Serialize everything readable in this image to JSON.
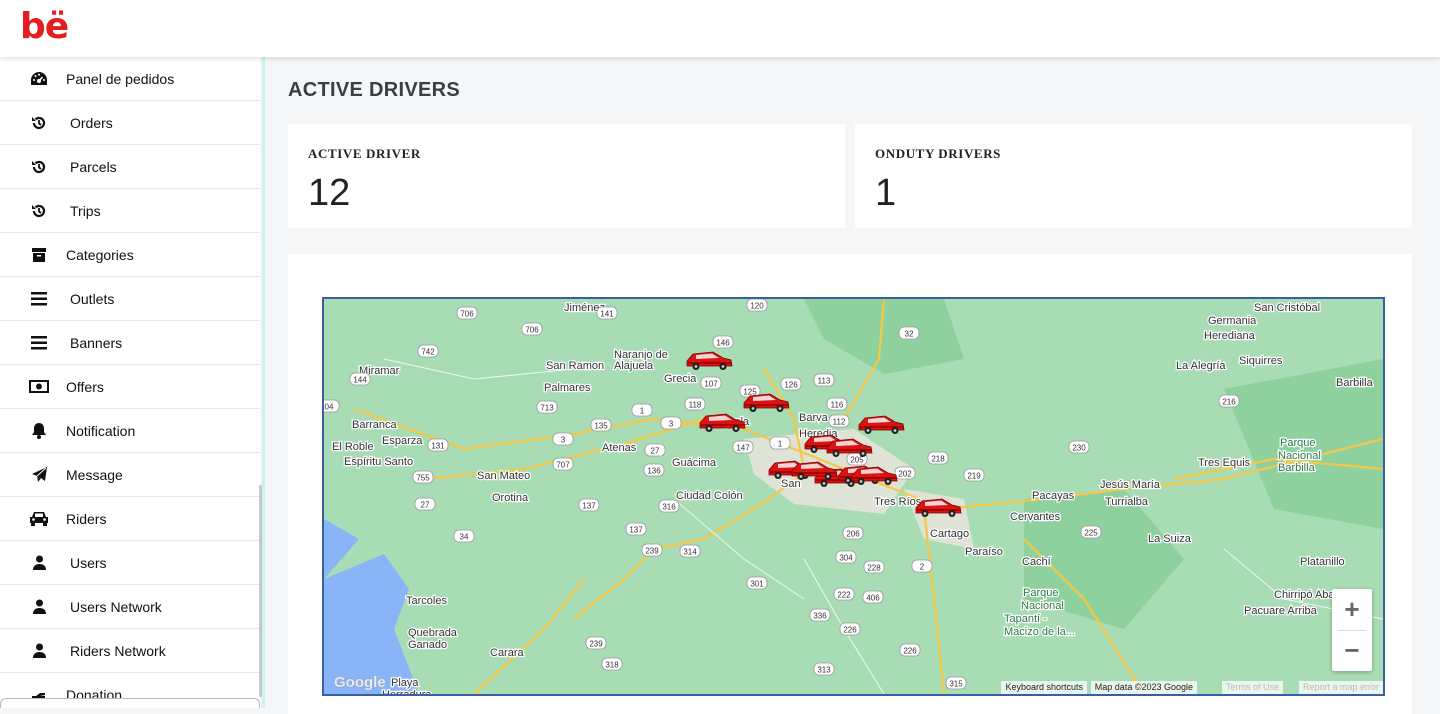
{
  "brand": {
    "logo": "bë",
    "color": "#e41e1e"
  },
  "sidebar": {
    "items": [
      {
        "label": "Panel de pedidos",
        "icon": "dashboard-icon"
      },
      {
        "label": "Orders",
        "icon": "history-icon"
      },
      {
        "label": "Parcels",
        "icon": "history-icon"
      },
      {
        "label": "Trips",
        "icon": "history-icon"
      },
      {
        "label": "Categories",
        "icon": "archive-icon"
      },
      {
        "label": "Outlets",
        "icon": "bars-icon"
      },
      {
        "label": "Banners",
        "icon": "bars-icon"
      },
      {
        "label": "Offers",
        "icon": "money-bill-icon"
      },
      {
        "label": "Notification",
        "icon": "bell-icon"
      },
      {
        "label": "Message",
        "icon": "paper-plane-icon"
      },
      {
        "label": "Riders",
        "icon": "car-icon"
      },
      {
        "label": "Users",
        "icon": "user-icon"
      },
      {
        "label": "Users Network",
        "icon": "user-icon"
      },
      {
        "label": "Riders Network",
        "icon": "user-icon"
      },
      {
        "label": "Donation",
        "icon": "hand-icon"
      }
    ]
  },
  "page": {
    "title": "ACTIVE DRIVERS"
  },
  "stats": {
    "active_label": "ACTIVE DRIVER",
    "active_value": "12",
    "onduty_label": "ONDUTY DRIVERS",
    "onduty_value": "1"
  },
  "map": {
    "zoom_in": "+",
    "zoom_out": "−",
    "google_logo": "Google",
    "keyboard_shortcuts": "Keyboard shortcuts",
    "map_data": "Map data ©2023 Google",
    "terms": "Terms of Use",
    "report": "Report a map error",
    "places": [
      "Jiménez",
      "San Cristóbal",
      "Germania",
      "Herediana",
      "Miramar",
      "San Ramon",
      "Naranjo de",
      "Alajuela",
      "Grecia",
      "La Alegría",
      "Siquirres",
      "Barbilla",
      "Palmares",
      "Barva",
      "Heredia",
      "Alajuela",
      "Barranca",
      "Esparza",
      "El Roble",
      "Atenas",
      "Espíritu Santo",
      "Guácima",
      "Parque",
      "Nacional",
      "Barbilla",
      "Tres Equis",
      "San Mateo",
      "Orotina",
      "Ciudad Colón",
      "San",
      "Tres Ríos",
      "Jesús María",
      "Turrialba",
      "Pacayas",
      "Cervantes",
      "Cartago",
      "Paraíso",
      "Cachí",
      "La Suiza",
      "Platanillo",
      "Parque",
      "Nacional",
      "Tapantí -",
      "Macizo de la...",
      "Chirripó Abajo",
      "Pacuare Arriba",
      "Tarcoles",
      "Quebrada",
      "Ganado",
      "Carara",
      "Playa",
      "Herradura"
    ],
    "routes": [
      "706",
      "706",
      "141",
      "120",
      "146",
      "32",
      "742",
      "144",
      "107",
      "125",
      "126",
      "113",
      "04",
      "713",
      "1",
      "3",
      "135",
      "116",
      "118",
      "112",
      "216",
      "415",
      "131",
      "3",
      "27",
      "147",
      "1",
      "755",
      "707",
      "136",
      "230",
      "205",
      "218",
      "202",
      "219",
      "27",
      "137",
      "316",
      "34",
      "137",
      "239",
      "314",
      "206",
      "304",
      "228",
      "2",
      "225",
      "301",
      "222",
      "406",
      "336",
      "226",
      "239",
      "318",
      "226",
      "313",
      "315"
    ]
  }
}
